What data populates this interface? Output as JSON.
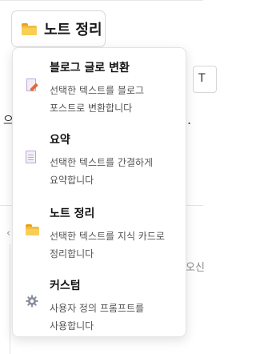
{
  "trigger": {
    "label": "노트 정리",
    "icon": "folder-icon"
  },
  "background": {
    "input_fragment": "T",
    "text_left": "으",
    "text_right": ".",
    "corner_glyph": "‹",
    "right_text": "오신"
  },
  "menu": {
    "items": [
      {
        "title": "블로그 글로 변환",
        "description": "선택한 텍스트를 블로그 포스트로 변환합니다",
        "icon": "document-pen-icon"
      },
      {
        "title": "요약",
        "description": "선택한 텍스트를 간결하게 요약합니다",
        "icon": "document-icon"
      },
      {
        "title": "노트 정리",
        "description": "선택한 텍스트를 지식 카드로 정리합니다",
        "icon": "folder-icon"
      },
      {
        "title": "커스텀",
        "description": "사용자 정의 프롬프트를 사용합니다",
        "icon": "gear-icon"
      }
    ]
  },
  "colors": {
    "folder": "#f3be3f",
    "gear": "#8a8fa0",
    "pen": "#e2683c",
    "border": "#e3e3e3"
  }
}
